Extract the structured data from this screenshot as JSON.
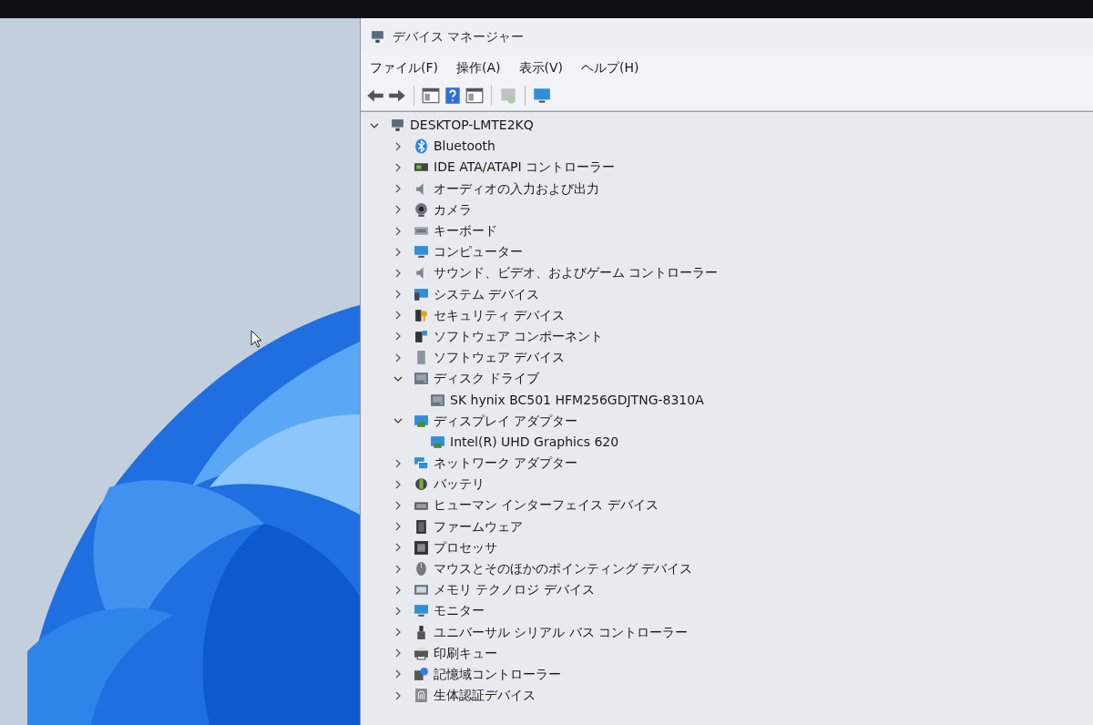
{
  "window": {
    "title": "デバイス マネージャー"
  },
  "menu": [
    "ファイル(F)",
    "操作(A)",
    "表示(V)",
    "ヘルプ(H)"
  ],
  "toolbar": [
    {
      "kind": "back",
      "disabled": false
    },
    {
      "kind": "forward",
      "disabled": false
    },
    {
      "kind": "panel",
      "disabled": false
    },
    {
      "kind": "help",
      "disabled": false
    },
    {
      "kind": "panel",
      "disabled": false
    },
    {
      "kind": "scan",
      "disabled": true
    },
    {
      "kind": "monitor",
      "disabled": false
    }
  ],
  "tree": {
    "label": "DESKTOP-LMTE2KQ",
    "kind": "computer",
    "expanded": true,
    "children": [
      {
        "label": "Bluetooth",
        "kind": "bluetooth",
        "expanded": false
      },
      {
        "label": "IDE ATA/ATAPI コントローラー",
        "kind": "controller",
        "expanded": false
      },
      {
        "label": "オーディオの入力および出力",
        "kind": "speaker",
        "expanded": false
      },
      {
        "label": "カメラ",
        "kind": "camera",
        "expanded": false
      },
      {
        "label": "キーボード",
        "kind": "keyboard",
        "expanded": false
      },
      {
        "label": "コンピューター",
        "kind": "monitor",
        "expanded": false
      },
      {
        "label": "サウンド、ビデオ、およびゲーム コントローラー",
        "kind": "speaker",
        "expanded": false
      },
      {
        "label": "システム デバイス",
        "kind": "system",
        "expanded": false
      },
      {
        "label": "セキュリティ デバイス",
        "kind": "key",
        "expanded": false
      },
      {
        "label": "ソフトウェア コンポーネント",
        "kind": "component",
        "expanded": false
      },
      {
        "label": "ソフトウェア デバイス",
        "kind": "device",
        "expanded": false
      },
      {
        "label": "ディスク ドライブ",
        "kind": "disk",
        "expanded": true,
        "children": [
          {
            "label": "SK hynix BC501 HFM256GDJTNG-8310A",
            "kind": "disk"
          }
        ]
      },
      {
        "label": "ディスプレイ アダプター",
        "kind": "display",
        "expanded": true,
        "children": [
          {
            "label": "Intel(R) UHD Graphics 620",
            "kind": "display"
          }
        ]
      },
      {
        "label": "ネットワーク アダプター",
        "kind": "network",
        "expanded": false
      },
      {
        "label": "バッテリ",
        "kind": "battery",
        "expanded": false
      },
      {
        "label": "ヒューマン インターフェイス デバイス",
        "kind": "hid",
        "expanded": false
      },
      {
        "label": "ファームウェア",
        "kind": "firmware",
        "expanded": false
      },
      {
        "label": "プロセッサ",
        "kind": "cpu",
        "expanded": false
      },
      {
        "label": "マウスとそのほかのポインティング デバイス",
        "kind": "mouse",
        "expanded": false
      },
      {
        "label": "メモリ テクノロジ デバイス",
        "kind": "memory",
        "expanded": false
      },
      {
        "label": "モニター",
        "kind": "monitor",
        "expanded": false
      },
      {
        "label": "ユニバーサル シリアル バス コントローラー",
        "kind": "usb",
        "expanded": false
      },
      {
        "label": "印刷キュー",
        "kind": "printer",
        "expanded": false
      },
      {
        "label": "記憶域コントローラー",
        "kind": "storage",
        "expanded": false
      },
      {
        "label": "生体認証デバイス",
        "kind": "fingerprint",
        "expanded": false
      }
    ]
  }
}
